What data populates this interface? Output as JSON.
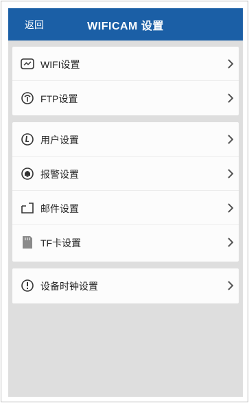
{
  "header": {
    "back_label": "返回",
    "title": "WIFICAM  设置"
  },
  "groups": [
    {
      "items": [
        {
          "label": "WIFI设置",
          "icon": "wifi-settings-icon"
        },
        {
          "label": "FTP设置",
          "icon": "ftp-settings-icon"
        }
      ]
    },
    {
      "items": [
        {
          "label": "用户设置",
          "icon": "user-settings-icon"
        },
        {
          "label": "报警设置",
          "icon": "alarm-settings-icon"
        },
        {
          "label": "邮件设置",
          "icon": "mail-settings-icon"
        },
        {
          "label": "TF卡设置",
          "icon": "sd-card-icon"
        }
      ]
    },
    {
      "items": [
        {
          "label": "设备时钟设置",
          "icon": "clock-alert-icon"
        }
      ]
    }
  ],
  "colors": {
    "titlebar": "#1b5fa6",
    "background": "#dedede",
    "row": "#fcfcfc"
  }
}
